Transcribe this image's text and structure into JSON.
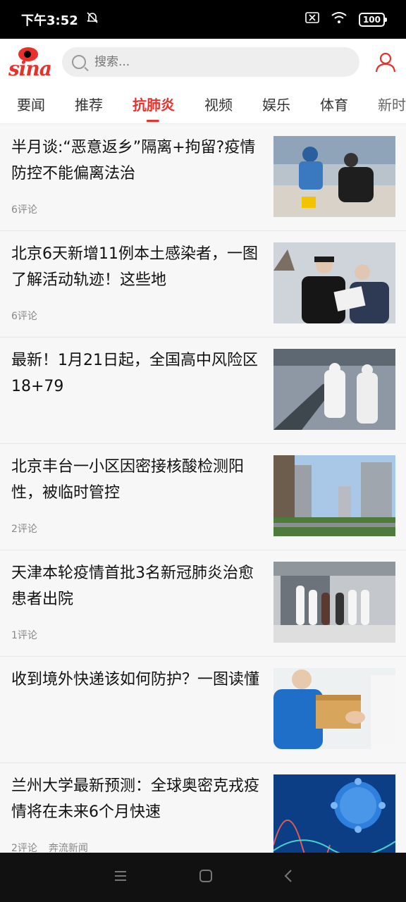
{
  "status": {
    "time": "下午3:52",
    "battery": "100"
  },
  "header": {
    "logo_text": "sina",
    "search_placeholder": "搜索..."
  },
  "tabs": [
    "要闻",
    "推荐",
    "抗肺炎",
    "视频",
    "娱乐",
    "体育",
    "新时"
  ],
  "active_tab": "抗肺炎",
  "colors": {
    "accent": "#e8312b"
  },
  "news": [
    {
      "title": "半月谈:“恶意返乡”隔离+拘留?疫情防控不能偏离法治",
      "comments": "6评论",
      "source": ""
    },
    {
      "title": "北京6天新增11例本土感染者，一图了解活动轨迹！这些地",
      "comments": "6评论",
      "source": ""
    },
    {
      "title": "最新！1月21日起，全国高中风险区18+79",
      "comments": "",
      "source": ""
    },
    {
      "title": "北京丰台一小区因密接核酸检测阳性，被临时管控",
      "comments": "2评论",
      "source": ""
    },
    {
      "title": "天津本轮疫情首批3名新冠肺炎治愈患者出院",
      "comments": "1评论",
      "source": ""
    },
    {
      "title": "收到境外快递该如何防护？一图读懂",
      "comments": "",
      "source": ""
    },
    {
      "title": "兰州大学最新预测：全球奥密克戎疫情将在未来6个月快速",
      "comments": "2评论",
      "source": "奔流新闻"
    }
  ]
}
